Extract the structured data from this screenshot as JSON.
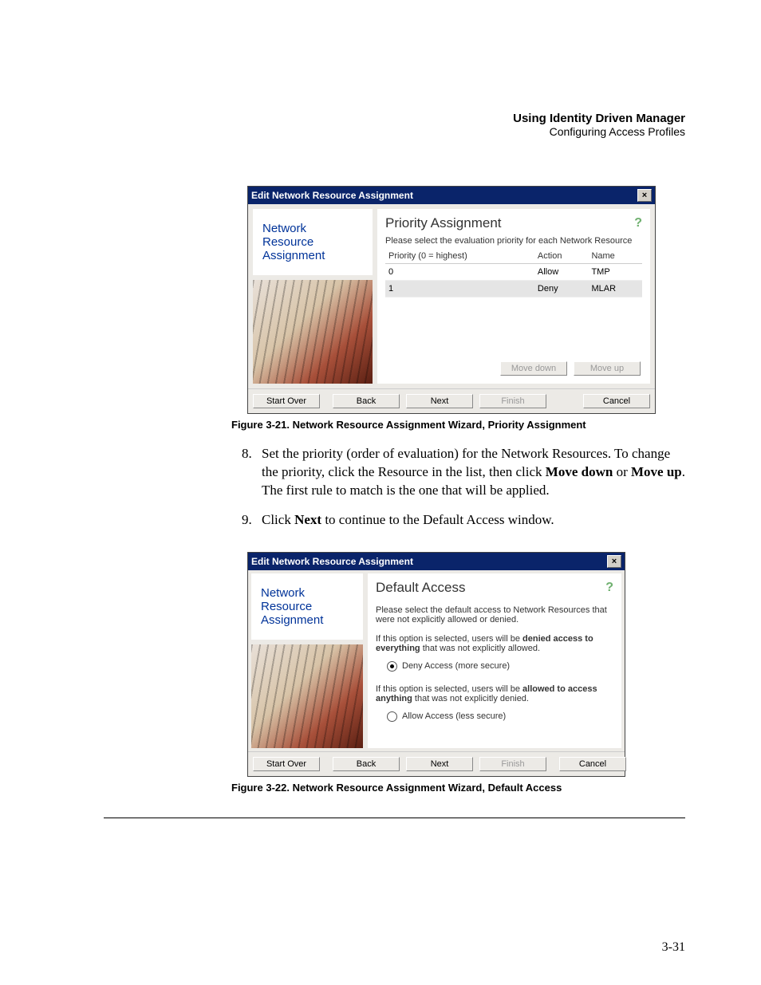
{
  "running_head": {
    "title": "Using Identity Driven Manager",
    "subtitle": "Configuring Access Profiles"
  },
  "page_number": "3-31",
  "fig1": {
    "caption": "Figure 3-21. Network Resource Assignment Wizard, Priority Assignment",
    "titlebar": "Edit Network Resource Assignment",
    "left_label_l1": "Network",
    "left_label_l2": "Resource",
    "left_label_l3": "Assignment",
    "heading": "Priority Assignment",
    "instruction": "Please select the evaluation priority for each Network Resource",
    "cols": {
      "c1": "Priority (0 = highest)",
      "c2": "Action",
      "c3": "Name"
    },
    "rows": [
      {
        "priority": "0",
        "action": "Allow",
        "name": "TMP"
      },
      {
        "priority": "1",
        "action": "Deny",
        "name": "MLAR"
      }
    ],
    "move_down": "Move down",
    "move_up": "Move up",
    "start_over": "Start Over",
    "back": "Back",
    "next": "Next",
    "finish": "Finish",
    "cancel": "Cancel"
  },
  "step8": {
    "num": "8.",
    "txt_a": "Set the priority (order of evaluation) for the Network Resources. To change the priority, click the Resource in the list, then click ",
    "btn1": "Move down",
    "txt_b": " or ",
    "btn2": "Move up",
    "txt_c": ". The first rule to match is the one that will be applied."
  },
  "step9": {
    "num": "9.",
    "txt_a": "Click ",
    "btn1": "Next",
    "txt_b": " to continue to the Default Access window."
  },
  "fig2": {
    "caption": "Figure 3-22. Network Resource Assignment Wizard, Default Access",
    "titlebar": "Edit Network Resource Assignment",
    "left_label_l1": "Network",
    "left_label_l2": "Resource",
    "left_label_l3": "Assignment",
    "heading": "Default Access",
    "instruction": "Please select the default access to Network Resources that were not explicitly allowed or denied.",
    "deny_pre": "If this option is selected, users will be ",
    "deny_bold": "denied access to everything",
    "deny_post": " that was not explicitly allowed.",
    "deny_radio": "Deny Access   (more secure)",
    "allow_pre": "If this option is selected, users will be ",
    "allow_bold": "allowed to access anything",
    "allow_post": " that was not explicitly denied.",
    "allow_radio": "Allow Access   (less secure)",
    "start_over": "Start Over",
    "back": "Back",
    "next": "Next",
    "finish": "Finish",
    "cancel": "Cancel"
  }
}
